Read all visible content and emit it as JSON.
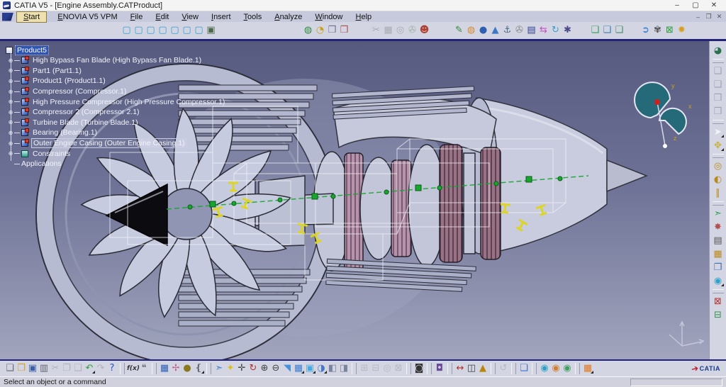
{
  "window": {
    "title": "CATIA V5 - [Engine Assembly.CATProduct]",
    "controls": {
      "minimize": "–",
      "maximize": "▢",
      "close": "✕"
    }
  },
  "menu": {
    "items": [
      "Start",
      "ENOVIA V5 VPM",
      "File",
      "Edit",
      "View",
      "Insert",
      "Tools",
      "Analyze",
      "Window",
      "Help"
    ],
    "mdi_controls": {
      "minimize": "–",
      "restore": "❐",
      "close": "✕"
    }
  },
  "top_toolbar": {
    "groups": [
      {
        "name": "view-cube-toolbar",
        "icons": [
          {
            "name": "view-cube-1-icon",
            "glyph": "▢",
            "color": "#2e9fd4"
          },
          {
            "name": "view-cube-2-icon",
            "glyph": "▢",
            "color": "#2e9fd4"
          },
          {
            "name": "view-cube-3-icon",
            "glyph": "▢",
            "color": "#2e9fd4"
          },
          {
            "name": "view-cube-4-icon",
            "glyph": "▢",
            "color": "#2e9fd4"
          },
          {
            "name": "view-cube-5-icon",
            "glyph": "▢",
            "color": "#2e9fd4"
          },
          {
            "name": "view-cube-6-icon",
            "glyph": "▢",
            "color": "#2e9fd4"
          },
          {
            "name": "view-cube-7-icon",
            "glyph": "▢",
            "color": "#2e9fd4"
          },
          {
            "name": "capture-cube-icon",
            "glyph": "▣",
            "color": "#4a6a4a"
          }
        ]
      },
      {
        "name": "enovia-toolbar",
        "icons": [
          {
            "name": "enovia-pen-globe-icon",
            "glyph": "◍",
            "color": "#2f8f3f"
          },
          {
            "name": "enovia-globe-doc-icon",
            "glyph": "◔",
            "color": "#c9a21a"
          },
          {
            "name": "workbook-icon",
            "glyph": "❒",
            "color": "#6a7090"
          },
          {
            "name": "workbook-red-icon",
            "glyph": "❒",
            "color": "#a85050"
          }
        ]
      },
      {
        "name": "edit-tools-toolbar",
        "icons": [
          {
            "name": "cut-icon",
            "glyph": "✂",
            "color": "#777",
            "dim": true
          },
          {
            "name": "stamp-icon",
            "glyph": "▦",
            "color": "#777",
            "dim": true
          },
          {
            "name": "preview-icon",
            "glyph": "◎",
            "color": "#777",
            "dim": true
          },
          {
            "name": "attach-leaf-icon",
            "glyph": "✇",
            "color": "#5a8a5a",
            "dim": true
          },
          {
            "name": "publish-person-icon",
            "glyph": "☻",
            "color": "#b04030"
          }
        ]
      },
      {
        "name": "knowledge-toolbar",
        "icons": [
          {
            "name": "pen-icon",
            "glyph": "✎",
            "color": "#2e8b3a"
          },
          {
            "name": "torus-icon",
            "glyph": "◍",
            "color": "#d88a2a"
          },
          {
            "name": "sphere-icon",
            "glyph": "●",
            "color": "#2e5fb0"
          },
          {
            "name": "pyramid-icon",
            "glyph": "▲",
            "color": "#3a78c8"
          },
          {
            "name": "anchor-icon",
            "glyph": "⚓",
            "color": "#4a6a8a"
          },
          {
            "name": "paperclip-icon",
            "glyph": "✇",
            "color": "#888"
          },
          {
            "name": "notepad-icon",
            "glyph": "▤",
            "color": "#2f3f8f"
          },
          {
            "name": "swap-arrows-icon",
            "glyph": "⇆",
            "color": "#c44fc4"
          },
          {
            "name": "refresh-icon",
            "glyph": "↻",
            "color": "#3aa0d0"
          },
          {
            "name": "gear-asterisk-icon",
            "glyph": "✱",
            "color": "#4a4a8a"
          }
        ]
      },
      {
        "name": "output-toolbar",
        "icons": [
          {
            "name": "export-icon",
            "glyph": "❑",
            "color": "#2f9e4f"
          },
          {
            "name": "import-icon",
            "glyph": "❑",
            "color": "#2f7fae"
          },
          {
            "name": "batch-icon",
            "glyph": "❑",
            "color": "#3f8f5f"
          }
        ]
      },
      {
        "name": "misc-toolbar",
        "icons": [
          {
            "name": "open-arrow-icon",
            "glyph": "➲",
            "color": "#3a7fd0"
          },
          {
            "name": "gears-icon",
            "glyph": "✾",
            "color": "#555"
          },
          {
            "name": "green-x-box-icon",
            "glyph": "⊠",
            "color": "#2f9e3f"
          },
          {
            "name": "gold-star-icon",
            "glyph": "✹",
            "color": "#d8a020"
          }
        ]
      }
    ]
  },
  "tree": {
    "expander_glyph": "⊕",
    "root": {
      "label": "Product5"
    },
    "items": [
      {
        "label": "High Bypass Fan Blade (High Bypass Fan Blade.1)",
        "icon": "part"
      },
      {
        "label": "Part1 (Part1.1)",
        "icon": "part"
      },
      {
        "label": "Product1 (Product1.1)",
        "icon": "part"
      },
      {
        "label": "Compressor (Compressor.1)",
        "icon": "part"
      },
      {
        "label": "High Pressure Compressor (High Pressure Compressor.1)",
        "icon": "part"
      },
      {
        "label": "Compressor 2 (Compressor 2.1)",
        "icon": "part"
      },
      {
        "label": "Turbine Blade (Turbine Blade.1)",
        "icon": "part"
      },
      {
        "label": "Bearing (Bearing.1)",
        "icon": "part"
      },
      {
        "label": "Outer Engine Casing (Outer Engine Casing.1)",
        "icon": "part",
        "preselected": true
      },
      {
        "label": "Constraints",
        "icon": "constraints"
      },
      {
        "label": "Applications",
        "icon": null,
        "leaf": true
      }
    ]
  },
  "viewport": {
    "background_top": "#565a7e",
    "background_bottom": "#a2a5bd",
    "model_body_color": "#c3c6d9",
    "model_blade_pink": "#b593aa",
    "constraint_green": "#17a62e",
    "constraint_yellow": "#ded61f",
    "wireframe_white": "#f2f2f6",
    "compass_axis_labels": {
      "x": "x",
      "y": "y",
      "z": "z"
    }
  },
  "right_toolbar": {
    "icons": [
      {
        "name": "assembly-workbench-icon",
        "glyph": "◕",
        "color": "#2a6f4f"
      },
      {
        "sep": true
      },
      {
        "name": "new-component-icon",
        "glyph": "❑",
        "color": "#9aa0b8"
      },
      {
        "name": "new-product-icon",
        "glyph": "❑",
        "color": "#9aa0b8"
      },
      {
        "name": "new-part-icon",
        "glyph": "❒",
        "color": "#9aa0b8"
      },
      {
        "name": "existing-component-icon",
        "glyph": "❒",
        "color": "#9aa0b8"
      },
      {
        "sep": true
      },
      {
        "name": "select-icon",
        "glyph": "➤",
        "color": "#f4f4f8",
        "drop": true
      },
      {
        "name": "manipulate-icon",
        "glyph": "✥",
        "color": "#c8b040",
        "drop": true
      },
      {
        "sep": true
      },
      {
        "name": "coincidence-constraint-icon",
        "glyph": "◎",
        "color": "#b88a20"
      },
      {
        "name": "contact-constraint-icon",
        "glyph": "◐",
        "color": "#b88a20"
      },
      {
        "name": "offset-constraint-icon",
        "glyph": "∥",
        "color": "#b88a20"
      },
      {
        "sep": true
      },
      {
        "name": "existing-component-arrow-icon",
        "glyph": "➣",
        "color": "#2f9e4f"
      },
      {
        "name": "smart-move-icon",
        "glyph": "✸",
        "color": "#b05050"
      },
      {
        "name": "catalog-browser-icon",
        "glyph": "▤",
        "color": "#555"
      },
      {
        "name": "multi-instantiation-icon",
        "glyph": "▦",
        "color": "#b88a20"
      },
      {
        "name": "paste-components-icon",
        "glyph": "❐",
        "color": "#3a6fb0"
      },
      {
        "name": "knowledge-globe-icon",
        "glyph": "◉",
        "color": "#2fa0c8",
        "drop": true
      },
      {
        "sep": true
      },
      {
        "name": "clash-analysis-icon",
        "glyph": "⊠",
        "color": "#b03030"
      },
      {
        "name": "sectioning-icon",
        "glyph": "⊟",
        "color": "#2f8f4f"
      }
    ]
  },
  "bottom_toolbar": {
    "icons": [
      {
        "name": "new-document-icon",
        "glyph": "❏",
        "color": "#667"
      },
      {
        "name": "open-icon",
        "glyph": "❐",
        "color": "#d8a020"
      },
      {
        "name": "save-icon",
        "glyph": "▣",
        "color": "#3a5fa8"
      },
      {
        "name": "print-icon",
        "glyph": "▥",
        "color": "#667"
      },
      {
        "name": "cut-icon",
        "glyph": "✂",
        "color": "#888",
        "dim": true
      },
      {
        "name": "copy-icon",
        "glyph": "❐",
        "color": "#888",
        "dim": true
      },
      {
        "name": "paste-icon",
        "glyph": "❑",
        "color": "#888",
        "dim": true
      },
      {
        "name": "undo-icon",
        "glyph": "↶",
        "color": "#2d9e3a",
        "drop": true
      },
      {
        "name": "redo-icon",
        "glyph": "↷",
        "color": "#888",
        "dim": true
      },
      {
        "name": "whats-this-icon",
        "glyph": "?",
        "color": "#2255cc"
      },
      {
        "sep": true
      },
      {
        "name": "formula-icon",
        "text": "f(x)",
        "color": "#333"
      },
      {
        "name": "comment-icon",
        "glyph": "❝",
        "color": "#777"
      },
      {
        "sep": true
      },
      {
        "name": "macro-window-icon",
        "glyph": "▦",
        "color": "#2b5fb8"
      },
      {
        "name": "link-browser-icon",
        "glyph": "✢",
        "color": "#c06090"
      },
      {
        "name": "lock-icon",
        "glyph": "●",
        "color": "#8a7a1f"
      },
      {
        "name": "structure-icon",
        "glyph": "❴",
        "color": "#667",
        "drop": true
      },
      {
        "sep": true
      },
      {
        "name": "fly-mode-icon",
        "glyph": "➣",
        "color": "#3a7fd0"
      },
      {
        "name": "fit-all-in-icon",
        "glyph": "✦",
        "color": "#e0be18"
      },
      {
        "name": "pan-icon",
        "glyph": "✛",
        "color": "#444"
      },
      {
        "name": "rotate-icon",
        "glyph": "↻",
        "color": "#b03030"
      },
      {
        "name": "zoom-in-icon",
        "glyph": "⊕",
        "color": "#444"
      },
      {
        "name": "zoom-out-icon",
        "glyph": "⊖",
        "color": "#444"
      },
      {
        "name": "normal-view-icon",
        "glyph": "◥",
        "color": "#4a90d9"
      },
      {
        "name": "quick-views-icon",
        "glyph": "▦",
        "color": "#3f7fd0",
        "drop": true
      },
      {
        "name": "iso-view-icon",
        "glyph": "▣",
        "color": "#49a8e0",
        "drop": true
      },
      {
        "name": "render-style-icon",
        "glyph": "◑",
        "color": "#4a78c8",
        "drop": true
      },
      {
        "name": "split-view-1-icon",
        "glyph": "◧",
        "color": "#7a84a0"
      },
      {
        "name": "split-view-2-icon",
        "glyph": "◨",
        "color": "#7a84a0"
      },
      {
        "sep": true
      },
      {
        "name": "hide-show-icon",
        "glyph": "⊞",
        "color": "#999",
        "dim": true
      },
      {
        "name": "swap-space-icon",
        "glyph": "⊟",
        "color": "#999",
        "dim": true
      },
      {
        "name": "magnifier-gray-icon",
        "glyph": "◎",
        "color": "#999",
        "dim": true
      },
      {
        "name": "depth-effect-icon",
        "glyph": "⊠",
        "color": "#999",
        "dim": true
      },
      {
        "sep": true
      },
      {
        "name": "capture-icon",
        "glyph": "◙",
        "color": "#333"
      },
      {
        "sep": true
      },
      {
        "name": "section-icon",
        "glyph": "◘",
        "color": "#6a4a9a"
      },
      {
        "sep": true
      },
      {
        "name": "measure-between-icon",
        "glyph": "↔",
        "color": "#b03030"
      },
      {
        "name": "measure-item-icon",
        "glyph": "◫",
        "color": "#444"
      },
      {
        "name": "mass-properties-icon",
        "glyph": "▲",
        "color": "#b8860b"
      },
      {
        "sep": true
      },
      {
        "name": "update-icon",
        "glyph": "↺",
        "color": "#999",
        "dim": true
      },
      {
        "sep": true
      },
      {
        "name": "layers-icon",
        "glyph": "❏",
        "color": "#3f6fd0"
      },
      {
        "sep": true
      },
      {
        "name": "knowledgeware-1-icon",
        "glyph": "◉",
        "color": "#2fa0c8"
      },
      {
        "name": "knowledgeware-2-icon",
        "glyph": "◉",
        "color": "#d08030"
      },
      {
        "name": "knowledgeware-3-icon",
        "glyph": "◉",
        "color": "#40a060"
      },
      {
        "sep": true
      },
      {
        "name": "power-input-icon",
        "glyph": "▦",
        "color": "#e07820",
        "drop": true
      }
    ]
  },
  "branding": {
    "logo_text": "CATIA",
    "logo_swoosh": "➔"
  },
  "status_bar": {
    "message": "Select an object or a command"
  }
}
